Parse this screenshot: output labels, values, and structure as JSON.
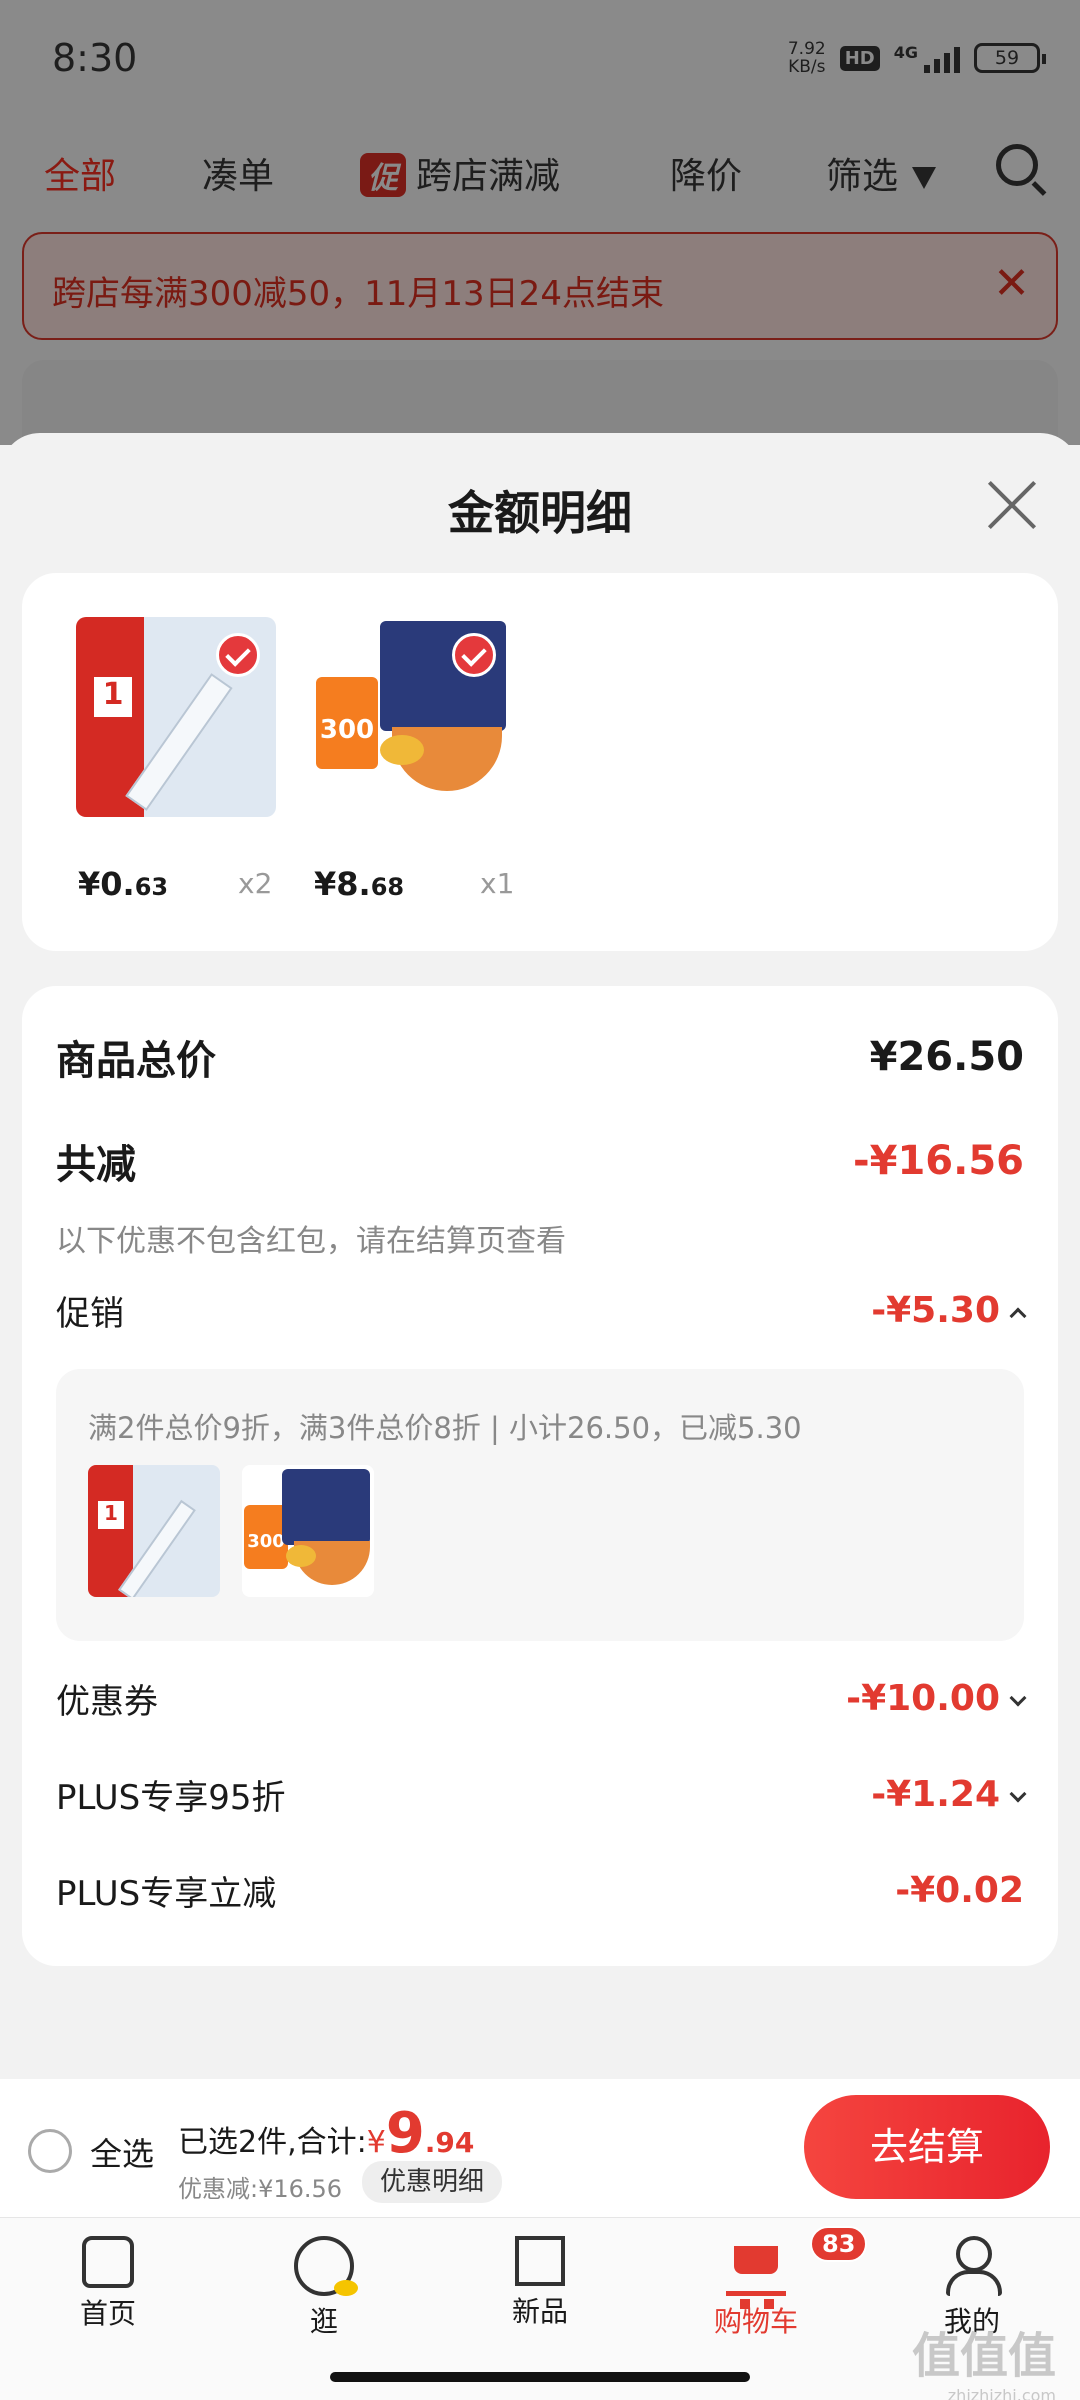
{
  "status_bar": {
    "time": "8:30",
    "net_speed_value": "7.92",
    "net_speed_unit": "KB/s",
    "hd": "HD",
    "network": "4G",
    "battery": "59"
  },
  "tabs": {
    "all": "全部",
    "bundle": "凑单",
    "promo_chip": "促",
    "cross_store": "跨店满减",
    "price_drop": "降价",
    "filter": "筛选"
  },
  "banner": {
    "text": "跨店每满300减50，11月13日24点结束",
    "close": "✕"
  },
  "sheet": {
    "title": "金额明细",
    "items": [
      {
        "price_int": "¥0.",
        "price_dec": "63",
        "qty": "x2"
      },
      {
        "price_int": "¥8.",
        "price_dec": "68",
        "qty": "x1"
      }
    ],
    "img_text": {
      "ruler_badge": "1",
      "snack_badge": "300"
    },
    "total": {
      "label": "商品总价",
      "value": "¥26.50"
    },
    "reduce": {
      "label": "共减",
      "value": "-¥16.56",
      "note": "以下优惠不包含红包，请在结算页查看"
    },
    "promo": {
      "label": "促销",
      "value": "-¥5.30",
      "desc": "满2件总价9折，满3件总价8折 | 小计26.50，已减5.30"
    },
    "coupon": {
      "label": "优惠券",
      "value": "-¥10.00"
    },
    "plus95": {
      "label": "PLUS专享95折",
      "value": "-¥1.24"
    },
    "plus_cut": {
      "label": "PLUS专享立减",
      "value": "-¥0.02"
    }
  },
  "checkout": {
    "select_all": "全选",
    "summary_prefix": "已选2件,合计:",
    "yen": "¥",
    "total_int": "9",
    "total_dec": ".94",
    "saved": "优惠减:¥16.56",
    "detail_button": "优惠明细",
    "go_button": "去结算"
  },
  "nav": {
    "home": "首页",
    "stroll": "逛",
    "new": "新品",
    "cart": "购物车",
    "cart_badge": "83",
    "me": "我的"
  },
  "watermark": {
    "main": "值值值",
    "sub": "zhizhizhi.com"
  },
  "colors": {
    "accent": "#e23a30",
    "checkout_button": "#f5453f"
  }
}
